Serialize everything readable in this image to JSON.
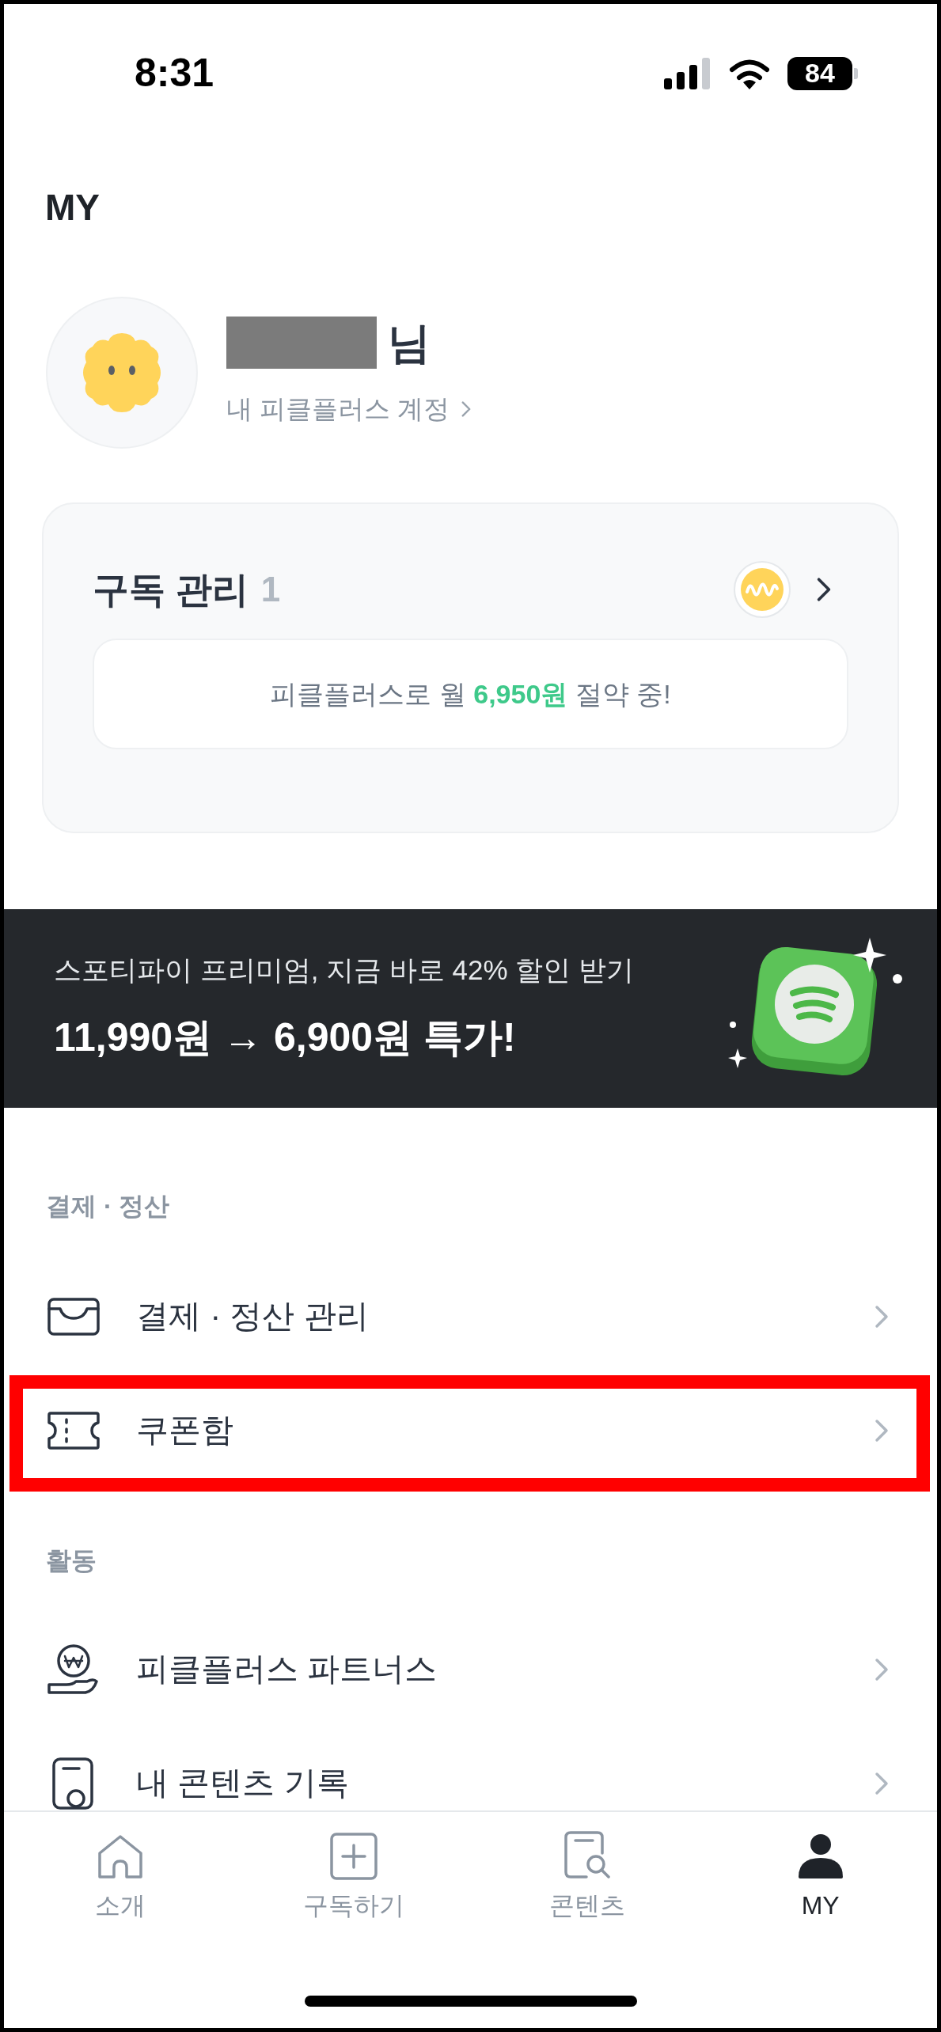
{
  "status_bar": {
    "time": "8:31",
    "battery": "84"
  },
  "header": {
    "title": "MY"
  },
  "profile": {
    "name_suffix": "님",
    "account_link": "내 피클플러스 계정"
  },
  "subscription": {
    "title": "구독 관리",
    "count": "1",
    "savings": "피클플러스로 월 **6,950원** 절약 중!"
  },
  "banner": {
    "subtitle": "스포티파이 프리미엄, 지금 바로 42% 할인 받기",
    "headline": "11,990원 → 6,900원 특가!"
  },
  "sections": [
    {
      "label": "결제 · 정산",
      "items": [
        {
          "label": "결제 · 정산 관리",
          "kind": "wallet",
          "highlighted": false
        },
        {
          "label": "쿠폰함",
          "kind": "ticket",
          "highlighted": true
        }
      ]
    },
    {
      "label": "활동",
      "items": [
        {
          "label": "피클플러스 파트너스",
          "kind": "partner",
          "highlighted": false
        },
        {
          "label": "내 콘텐츠 기록",
          "kind": "record",
          "highlighted": false
        }
      ]
    }
  ],
  "tab_bar": [
    {
      "label": "소개",
      "kind": "home",
      "selected": false
    },
    {
      "label": "구독하기",
      "kind": "subscribe",
      "selected": false
    },
    {
      "label": "콘텐츠",
      "kind": "contents",
      "selected": false
    },
    {
      "label": "MY",
      "kind": "profile",
      "selected": true
    }
  ]
}
